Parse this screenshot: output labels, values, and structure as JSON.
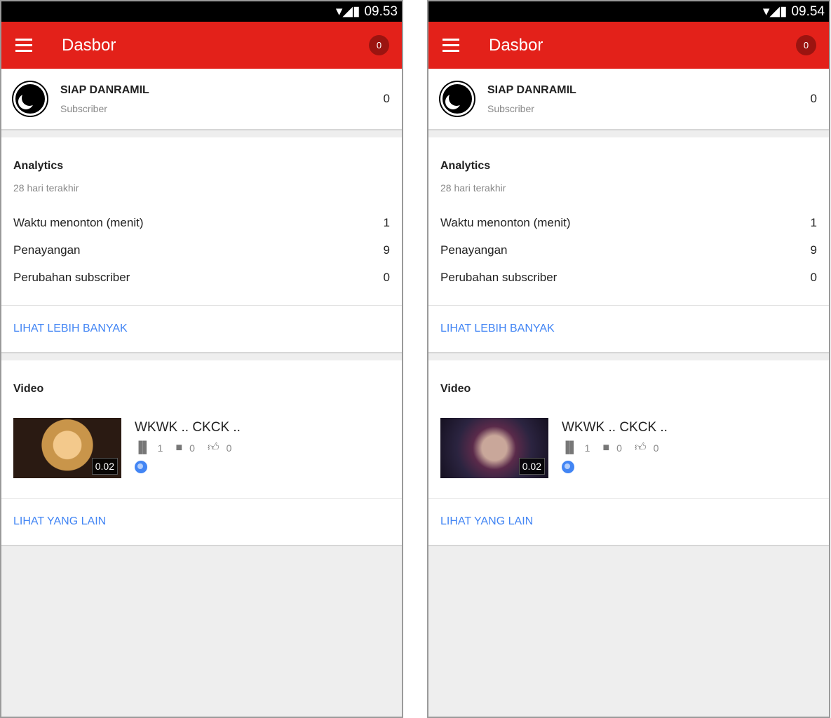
{
  "panels": [
    {
      "time": "09.53",
      "title": "Dasbor",
      "notif": "0",
      "channel": {
        "name": "SIAP DANRAMIL",
        "sub": "Subscriber",
        "count": "0"
      },
      "analytics": {
        "title": "Analytics",
        "period": "28 hari terakhir",
        "rows": [
          {
            "label": "Waktu menonton (menit)",
            "value": "1"
          },
          {
            "label": "Penayangan",
            "value": "9"
          },
          {
            "label": "Perubahan subscriber",
            "value": "0"
          }
        ],
        "more": "LIHAT LEBIH BANYAK"
      },
      "video": {
        "section": "Video",
        "title": "WKWK .. CKCK ..",
        "duration": "0.02",
        "views": "1",
        "comments": "0",
        "likes": "0",
        "more": "LIHAT YANG LAIN"
      }
    },
    {
      "time": "09.54",
      "title": "Dasbor",
      "notif": "0",
      "channel": {
        "name": "SIAP DANRAMIL",
        "sub": "Subscriber",
        "count": "0"
      },
      "analytics": {
        "title": "Analytics",
        "period": "28 hari terakhir",
        "rows": [
          {
            "label": "Waktu menonton (menit)",
            "value": "1"
          },
          {
            "label": "Penayangan",
            "value": "9"
          },
          {
            "label": "Perubahan subscriber",
            "value": "0"
          }
        ],
        "more": "LIHAT LEBIH BANYAK"
      },
      "video": {
        "section": "Video",
        "title": "WKWK .. CKCK ..",
        "duration": "0.02",
        "views": "1",
        "comments": "0",
        "likes": "0",
        "more": "LIHAT YANG LAIN"
      }
    }
  ],
  "colors": {
    "toolbar": "#e3211a",
    "link": "#4285f4"
  }
}
